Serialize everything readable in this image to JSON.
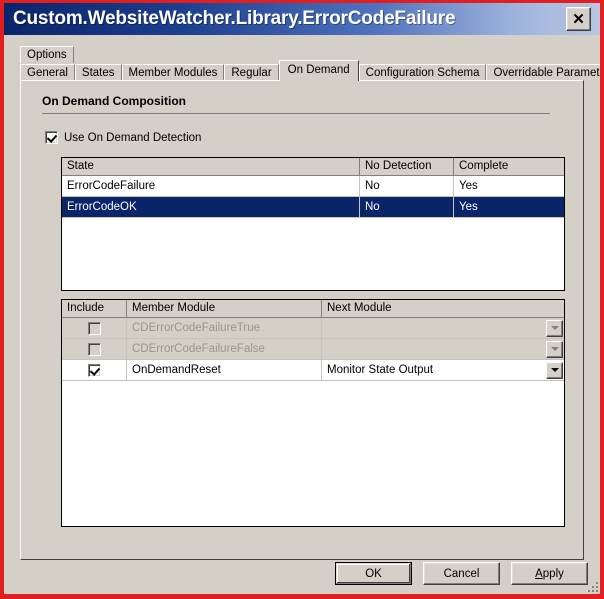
{
  "window": {
    "title": "Custom.WebsiteWatcher.Library.ErrorCodeFailure",
    "close_label": "✕",
    "titlebar_gradient_start": "#0a246a",
    "titlebar_gradient_end": "#b9c6e4",
    "face_color": "#d4d0c8",
    "capture_border_color": "#e02020"
  },
  "tabs": {
    "row1": [
      {
        "label": "Options",
        "selected": false
      }
    ],
    "row2": [
      {
        "label": "General",
        "selected": false
      },
      {
        "label": "States",
        "selected": false
      },
      {
        "label": "Member Modules",
        "selected": false
      },
      {
        "label": "Regular",
        "selected": false
      },
      {
        "label": "On Demand",
        "selected": true
      },
      {
        "label": "Configuration Schema",
        "selected": false
      },
      {
        "label": "Overridable Parameters",
        "selected": false
      }
    ]
  },
  "page": {
    "heading": "On Demand Composition",
    "use_on_demand": {
      "label": "Use On Demand Detection",
      "checked": true
    }
  },
  "states_grid": {
    "columns": [
      "State",
      "No Detection",
      "Complete"
    ],
    "rows": [
      {
        "state": "ErrorCodeFailure",
        "no_detection": "No",
        "complete": "Yes",
        "selected": false
      },
      {
        "state": "ErrorCodeOK",
        "no_detection": "No",
        "complete": "Yes",
        "selected": true
      }
    ],
    "selection_color": "#0a246a"
  },
  "modules_grid": {
    "columns": [
      "Include",
      "Member Module",
      "Next Module"
    ],
    "rows": [
      {
        "include": false,
        "member_module": "CDErrorCodeFailureTrue",
        "next_module": "",
        "disabled": true
      },
      {
        "include": false,
        "member_module": "CDErrorCodeFailureFalse",
        "next_module": "",
        "disabled": true
      },
      {
        "include": true,
        "member_module": "OnDemandReset",
        "next_module": "Monitor State Output",
        "disabled": false
      }
    ]
  },
  "buttons": {
    "ok": "OK",
    "cancel": "Cancel",
    "apply_pre": "A",
    "apply_post": "pply"
  }
}
